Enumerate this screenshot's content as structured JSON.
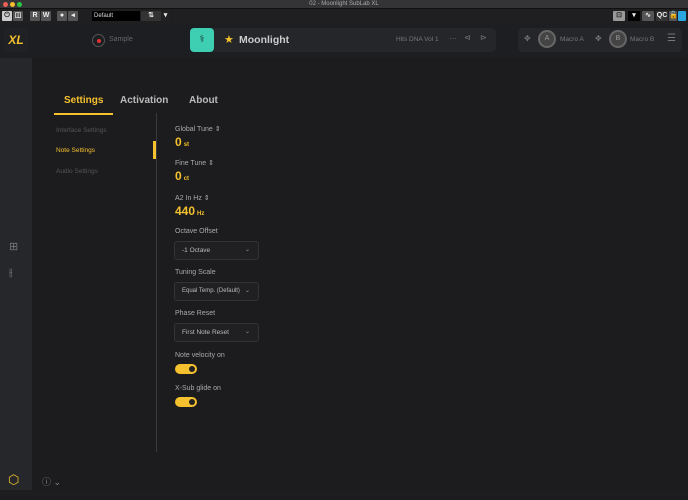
{
  "window": {
    "title": "02 - Moonlight SubLab XL"
  },
  "toolbar": {
    "r": "R",
    "w": "W",
    "preset": "Default",
    "qc": "QC"
  },
  "header": {
    "logo": "XL",
    "sample": "Sample",
    "preset_name": "Moonlight",
    "pack": "Hits DNA Vol 1",
    "more": "···",
    "macro_a": "Macro A",
    "macro_b": "Macro B",
    "knob_a": "A",
    "knob_b": "B"
  },
  "tabs": [
    {
      "label": "Settings",
      "active": true
    },
    {
      "label": "Activation"
    },
    {
      "label": "About"
    }
  ],
  "nav": [
    {
      "label": "Interface Settings"
    },
    {
      "label": "Note Settings",
      "active": true
    },
    {
      "label": "Audio Settings"
    }
  ],
  "settings": {
    "global_tune": {
      "label": "Global Tune",
      "value": "0",
      "unit": "st"
    },
    "fine_tune": {
      "label": "Fine Tune",
      "value": "0",
      "unit": "ct"
    },
    "a2": {
      "label": "A2 In Hz",
      "value": "440",
      "unit": "Hz"
    },
    "octave_offset": {
      "label": "Octave Offset",
      "value": "-1 Octave"
    },
    "tuning_scale": {
      "label": "Tuning Scale",
      "value": "Equal Temp. (Default)"
    },
    "phase_reset": {
      "label": "Phase Reset",
      "value": "First Note Reset"
    },
    "note_velocity": {
      "label": "Note velocity on",
      "on": true
    },
    "xsub_glide": {
      "label": "X-Sub glide on",
      "on": true
    }
  },
  "colors": {
    "accent": "#f5c12e",
    "teal": "#3ecfb3"
  }
}
